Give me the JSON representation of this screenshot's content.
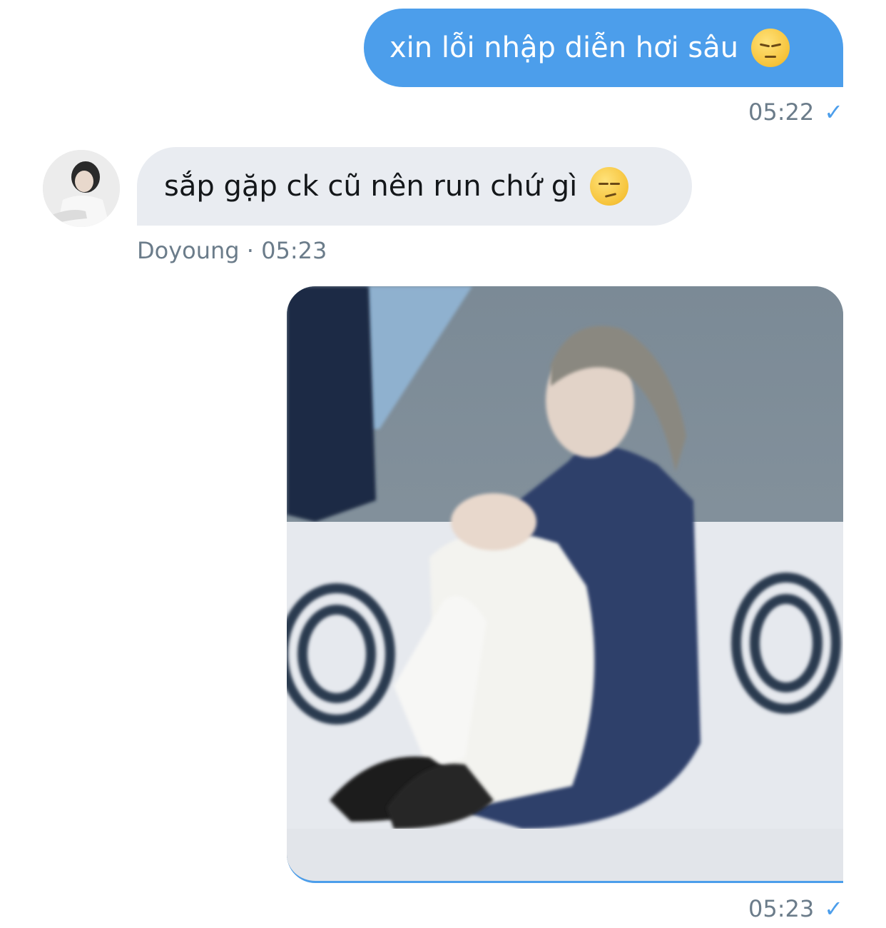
{
  "messages": [
    {
      "direction": "outgoing",
      "text": "xin lỗi nhập diễn hơi sâu",
      "emoji": "pensive-face-emoji",
      "time": "05:22"
    },
    {
      "direction": "incoming",
      "text": "sắp gặp ck cũ nên run chứ gì",
      "emoji": "smirking-face-emoji",
      "sender": "Doyoung",
      "separator": "·",
      "time": "05:23"
    },
    {
      "direction": "outgoing",
      "type": "image",
      "time": "05:23"
    }
  ],
  "checkmark": "✓",
  "colors": {
    "outgoing_bubble": "#4c9eeb",
    "incoming_bubble": "#e9ecf1",
    "meta_text": "#6b7c8a"
  }
}
